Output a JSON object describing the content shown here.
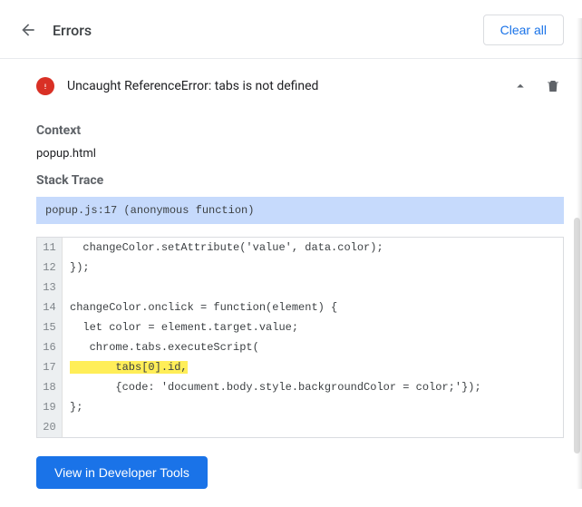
{
  "header": {
    "title": "Errors",
    "clear_all_label": "Clear all"
  },
  "error": {
    "message": "Uncaught ReferenceError: tabs is not defined"
  },
  "context": {
    "label": "Context",
    "value": "popup.html"
  },
  "stack": {
    "label": "Stack Trace",
    "frame": "popup.js:17 (anonymous function)"
  },
  "code": {
    "lines": [
      {
        "n": "11",
        "text": "  changeColor.setAttribute('value', data.color);",
        "hl": false
      },
      {
        "n": "12",
        "text": "});",
        "hl": false
      },
      {
        "n": "13",
        "text": "",
        "hl": false
      },
      {
        "n": "14",
        "text": "changeColor.onclick = function(element) {",
        "hl": false
      },
      {
        "n": "15",
        "text": "  let color = element.target.value;",
        "hl": false
      },
      {
        "n": "16",
        "text": "   chrome.tabs.executeScript(",
        "hl": false
      },
      {
        "n": "17",
        "text": "       tabs[0].id,",
        "hl": true
      },
      {
        "n": "18",
        "text": "       {code: 'document.body.style.backgroundColor = color;'});",
        "hl": false
      },
      {
        "n": "19",
        "text": "};",
        "hl": false
      },
      {
        "n": "20",
        "text": "",
        "hl": false
      }
    ]
  },
  "devtools_btn_label": "View in Developer Tools"
}
